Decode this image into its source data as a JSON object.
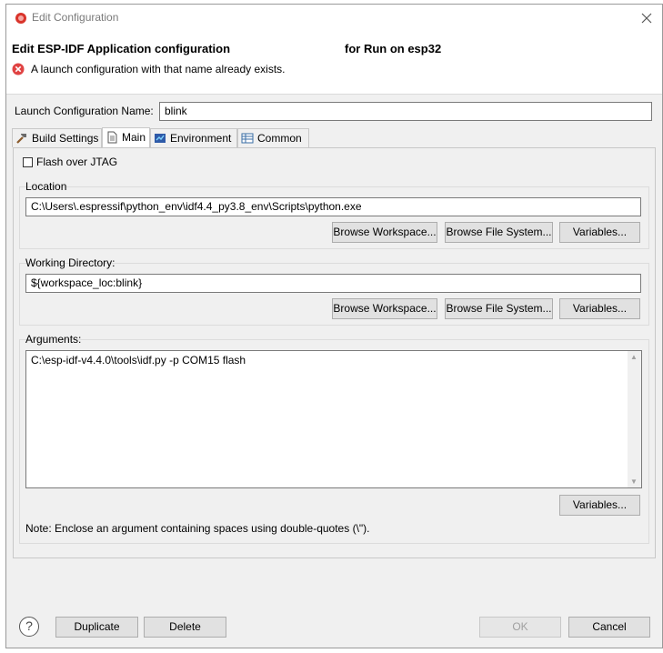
{
  "window": {
    "title": "Edit Configuration"
  },
  "header": {
    "title_prefix": "Edit ESP-IDF Application configuration",
    "title_suffix": "for Run on esp32",
    "error": "A launch configuration with that name already exists."
  },
  "name_field": {
    "label": "Launch Configuration Name:",
    "value": "blink"
  },
  "tabs": [
    {
      "label": "Build Settings"
    },
    {
      "label": "Main"
    },
    {
      "label": "Environment"
    },
    {
      "label": "Common"
    }
  ],
  "flash_jtag": {
    "label": "Flash over JTAG",
    "checked": false
  },
  "location": {
    "label": "Location",
    "value": "C:\\Users\\.espressif\\python_env\\idf4.4_py3.8_env\\Scripts\\python.exe",
    "browse_workspace": "Browse Workspace...",
    "browse_fs": "Browse File System...",
    "variables": "Variables..."
  },
  "working_dir": {
    "label": "Working Directory:",
    "value": "${workspace_loc:blink}",
    "browse_workspace": "Browse Workspace...",
    "browse_fs": "Browse File System...",
    "variables": "Variables..."
  },
  "arguments": {
    "label": "Arguments:",
    "value": "C:\\esp-idf-v4.4.0\\tools\\idf.py -p COM15 flash",
    "variables": "Variables...",
    "note": "Note: Enclose an argument containing spaces using double-quotes (\\\")."
  },
  "footer": {
    "duplicate": "Duplicate",
    "delete": "Delete",
    "ok": "OK",
    "cancel": "Cancel",
    "help_glyph": "?"
  },
  "colors": {
    "accent": "#0078d7",
    "error": "#e04343",
    "title": "#d9342b"
  }
}
